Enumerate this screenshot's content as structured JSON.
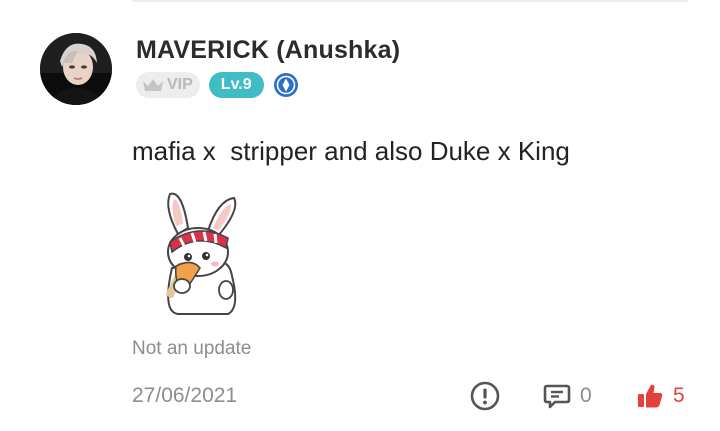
{
  "author": {
    "name": "MAVERICK (Anushka)",
    "vip_label": "VIP",
    "level_label": "Lv.9"
  },
  "post": {
    "text": "mafia x  stripper and also Duke x King",
    "note": "Not an update",
    "date": "27/06/2021"
  },
  "actions": {
    "report_icon": "exclamation-circle-icon",
    "comment_icon": "comment-icon",
    "comment_count": "0",
    "like_icon": "thumbs-up-icon",
    "like_count": "5"
  },
  "colors": {
    "level_badge": "#3fbcc4",
    "like_active": "#e4413e",
    "muted_text": "#8d8d8d",
    "shield_badge": "#2b6fc7"
  }
}
